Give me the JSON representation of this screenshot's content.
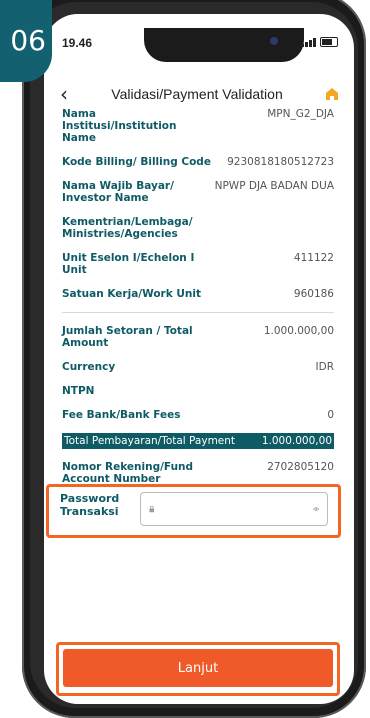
{
  "step": {
    "number": "06"
  },
  "status_bar": {
    "time": "19.46"
  },
  "header": {
    "title": "Validasi/Payment Validation",
    "back_icon": "chevron-left-icon",
    "home_icon": "home-icon"
  },
  "details": [
    {
      "label": "Nama Institusi/Institution Name",
      "value": "MPN_G2_DJA"
    },
    {
      "label": "Kode Billing/ Billing Code",
      "value": "9230818180512723"
    },
    {
      "label": "Nama Wajib Bayar/ Investor Name",
      "value": "NPWP DJA BADAN DUA"
    },
    {
      "label": "Kementrian/Lembaga/ Ministries/Agencies",
      "value": ""
    },
    {
      "label": "Unit Eselon I/Echelon I Unit",
      "value": "411122"
    },
    {
      "label": "Satuan Kerja/Work Unit",
      "value": "960186"
    }
  ],
  "payment": [
    {
      "label": "Jumlah Setoran / Total Amount",
      "value": "1.000.000,00"
    },
    {
      "label": "Currency",
      "value": "IDR"
    },
    {
      "label": "NTPN",
      "value": ""
    },
    {
      "label": "Fee Bank/Bank Fees",
      "value": "0"
    }
  ],
  "total": {
    "label": "Total Pembayaran/Total Payment",
    "value": "1.000.000,00"
  },
  "account": {
    "label": "Nomor Rekening/Fund Account Number",
    "value": "2702805120"
  },
  "password": {
    "label": "Password Transaksi",
    "value": "",
    "placeholder": ""
  },
  "action": {
    "label": "Lanjut"
  },
  "colors": {
    "brand": "#0f5b65",
    "accent": "#f05a28",
    "highlight": "#f26522"
  }
}
